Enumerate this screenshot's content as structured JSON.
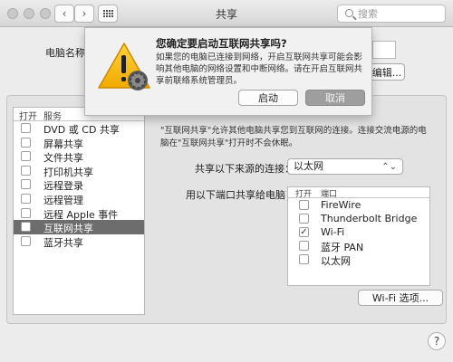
{
  "window": {
    "title": "共享"
  },
  "search": {
    "placeholder": "搜索"
  },
  "top": {
    "computer_name_label": "电脑名称",
    "edit_button": "编辑..."
  },
  "services": {
    "header_on": "打开",
    "header_service": "服务",
    "items": [
      {
        "label": "DVD 或 CD 共享",
        "checked": false,
        "selected": false
      },
      {
        "label": "屏幕共享",
        "checked": false,
        "selected": false
      },
      {
        "label": "文件共享",
        "checked": false,
        "selected": false
      },
      {
        "label": "打印机共享",
        "checked": false,
        "selected": false
      },
      {
        "label": "远程登录",
        "checked": false,
        "selected": false
      },
      {
        "label": "远程管理",
        "checked": false,
        "selected": false
      },
      {
        "label": "远程 Apple 事件",
        "checked": false,
        "selected": false
      },
      {
        "label": "互联网共享",
        "checked": false,
        "selected": true
      },
      {
        "label": "蓝牙共享",
        "checked": false,
        "selected": false
      }
    ]
  },
  "detail": {
    "description": "\"互联网共享\"允许其他电脑共享您到互联网的连接。连接交流电源的电脑在\"互联网共享\"打开时不会休眠。",
    "share_from_label": "共享以下来源的连接：",
    "share_from_value": "以太网",
    "to_ports_label": "用以下端口共享给电脑：",
    "ports_header_on": "打开",
    "ports_header_port": "端口",
    "ports": [
      {
        "label": "FireWire",
        "checked": false
      },
      {
        "label": "Thunderbolt Bridge",
        "checked": false
      },
      {
        "label": "Wi-Fi",
        "checked": true
      },
      {
        "label": "蓝牙 PAN",
        "checked": false
      },
      {
        "label": "以太网",
        "checked": false
      }
    ],
    "wifi_options_button": "Wi-Fi 选项..."
  },
  "help": {
    "label": "?"
  },
  "dialog": {
    "title": "您确定要启动互联网共享吗?",
    "body": "如果您的电脑已连接到网络，开启互联网共享可能会影响其他电脑的网络设置和中断网络。请在开启互联网共享前联络系统管理员。",
    "start_button": "启动",
    "cancel_button": "取消"
  },
  "icons": {
    "warning": "warning-triangle-icon",
    "gear": "gear-icon",
    "search": "search-icon",
    "help": "help-icon"
  }
}
